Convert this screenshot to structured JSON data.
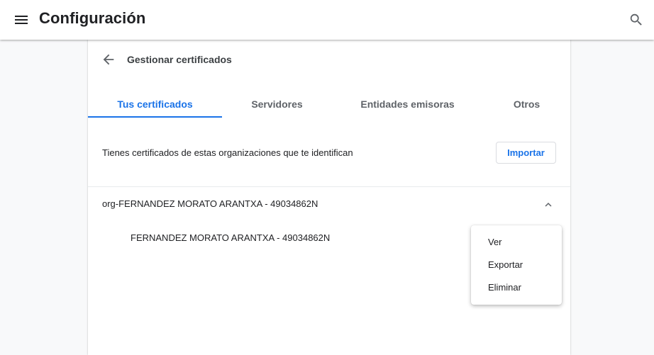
{
  "app": {
    "title": "Configuración"
  },
  "icons": {
    "menu": "hamburger-menu-icon",
    "search": "search-icon",
    "back": "arrow-back-icon",
    "chevron": "chevron-up-icon"
  },
  "colors": {
    "accent": "#1a73e8",
    "text": "#202124",
    "muted": "#5f6368"
  },
  "subpage": {
    "title": "Gestionar certificados"
  },
  "tabs": [
    {
      "label": "Tus certificados",
      "active": true
    },
    {
      "label": "Servidores",
      "active": false
    },
    {
      "label": "Entidades emisoras",
      "active": false
    },
    {
      "label": "Otros",
      "active": false
    }
  ],
  "certificates": {
    "description": "Tienes certificados de estas organizaciones que te identifican",
    "import_label": "Importar",
    "organization": {
      "name": "org-FERNANDEZ MORATO ARANTXA - 49034862N",
      "expanded": true,
      "items": [
        {
          "name": "FERNANDEZ MORATO ARANTXA - 49034862N"
        }
      ]
    }
  },
  "context_menu": {
    "items": [
      {
        "label": "Ver"
      },
      {
        "label": "Exportar"
      },
      {
        "label": "Eliminar"
      }
    ]
  }
}
